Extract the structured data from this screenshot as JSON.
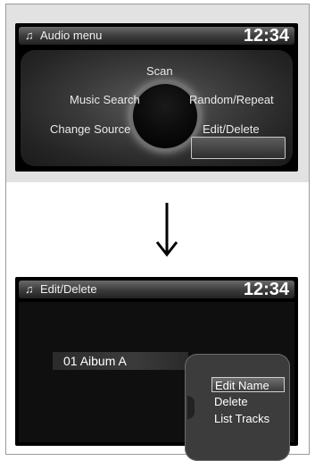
{
  "screen1": {
    "title": "Audio menu",
    "clock": "12:34",
    "items": {
      "scan": "Scan",
      "music_search": "Music Search",
      "random_repeat": "Random/Repeat",
      "change_source": "Change Source",
      "edit_delete": "Edit/Delete"
    },
    "selected": "edit_delete"
  },
  "screen2": {
    "title": "Edit/Delete",
    "clock": "12:34",
    "album": "01 Aibum A",
    "submenu": [
      "Edit Name",
      "Delete",
      "List Tracks"
    ],
    "selected_index": 0
  },
  "icons": {
    "title_icon": "music-note-icon",
    "arrow": "down-arrow-icon"
  }
}
